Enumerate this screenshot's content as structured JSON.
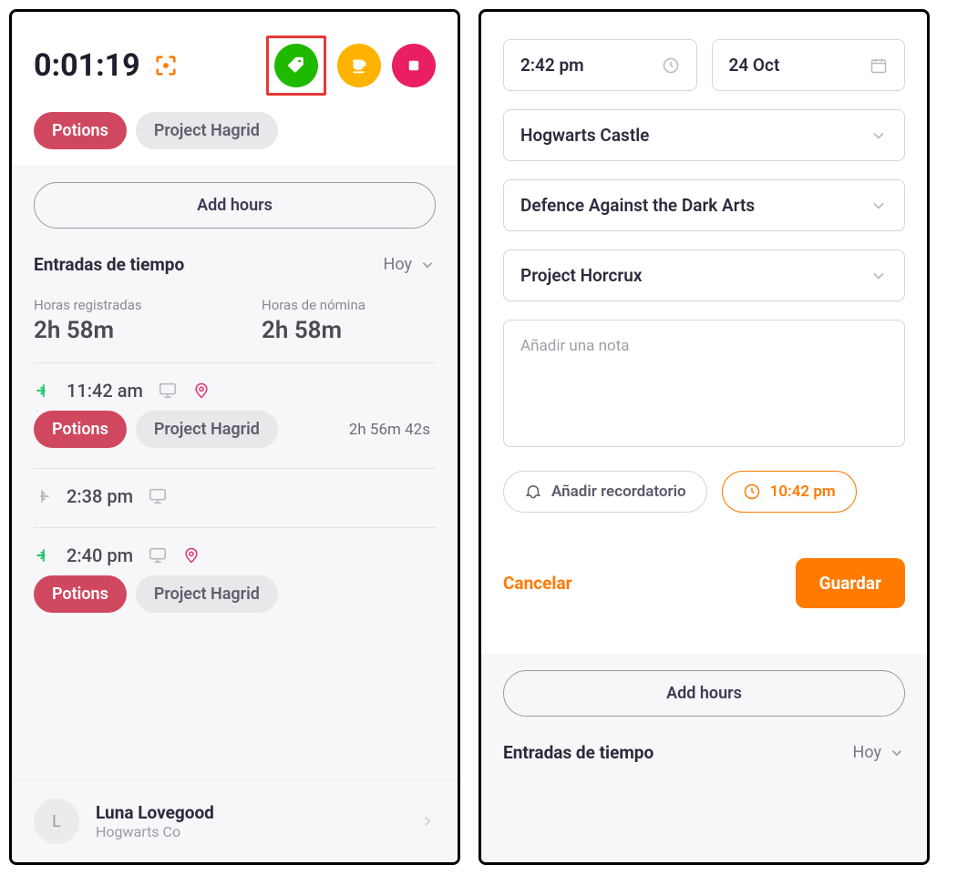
{
  "left": {
    "timer": "0:01:19",
    "tags": {
      "potion": "Potions",
      "hagrid": "Project Hagrid"
    },
    "add_hours": "Add hours",
    "entries_title": "Entradas de tiempo",
    "today": "Hoy",
    "stats": {
      "logged_label": "Horas registradas",
      "logged_value": "2h 58m",
      "payroll_label": "Horas de nómina",
      "payroll_value": "2h 58m"
    },
    "entries": [
      {
        "time": "11:42 am",
        "duration": "2h 56m 42s"
      },
      {
        "time": "2:38 pm"
      },
      {
        "time": "2:40 pm"
      }
    ],
    "user": {
      "initial": "L",
      "name": "Luna Lovegood",
      "company": "Hogwarts Co"
    }
  },
  "right": {
    "time": "2:42 pm",
    "date": "24 Oct",
    "location": "Hogwarts Castle",
    "department": "Defence Against the Dark Arts",
    "project": "Project Horcrux",
    "note_placeholder": "Añadir una nota",
    "reminder_add": "Añadir recordatorio",
    "reminder_time": "10:42 pm",
    "cancel": "Cancelar",
    "save": "Guardar",
    "add_hours": "Add hours",
    "entries_title": "Entradas de tiempo",
    "today": "Hoy"
  }
}
